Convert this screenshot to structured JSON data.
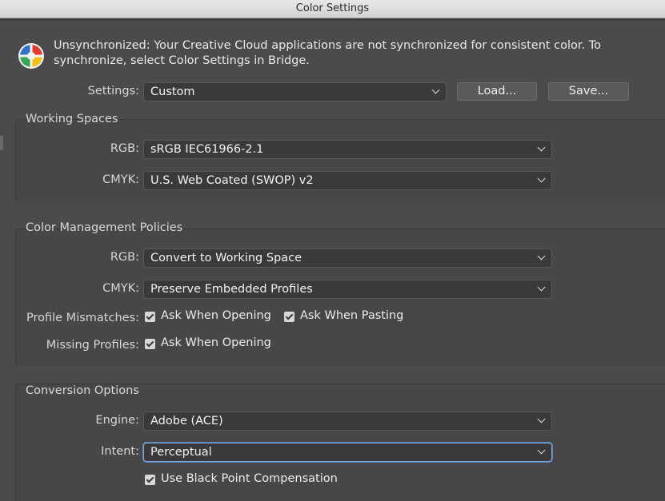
{
  "window": {
    "title": "Color Settings"
  },
  "notice": {
    "text": "Unsynchronized: Your Creative Cloud applications are not synchronized for consistent color. To synchronize, select Color Settings in Bridge."
  },
  "settings": {
    "label": "Settings:",
    "value": "Custom",
    "load_label": "Load...",
    "save_label": "Save..."
  },
  "working_spaces": {
    "title": "Working Spaces",
    "rgb_label": "RGB:",
    "rgb_value": "sRGB IEC61966-2.1",
    "cmyk_label": "CMYK:",
    "cmyk_value": "U.S. Web Coated (SWOP) v2"
  },
  "policies": {
    "title": "Color Management Policies",
    "rgb_label": "RGB:",
    "rgb_value": "Convert to Working Space",
    "cmyk_label": "CMYK:",
    "cmyk_value": "Preserve Embedded Profiles",
    "mismatch_label": "Profile Mismatches:",
    "ask_opening": "Ask When Opening",
    "ask_pasting": "Ask When Pasting",
    "missing_label": "Missing Profiles:",
    "missing_ask_opening": "Ask When Opening"
  },
  "conversion": {
    "title": "Conversion Options",
    "engine_label": "Engine:",
    "engine_value": "Adobe (ACE)",
    "intent_label": "Intent:",
    "intent_value": "Perceptual",
    "bpc_label": "Use Black Point Compensation"
  },
  "icons": {
    "app": "color-wheel-icon",
    "dropdown": "chevron-down-icon",
    "checkbox": "checkmark-icon"
  }
}
